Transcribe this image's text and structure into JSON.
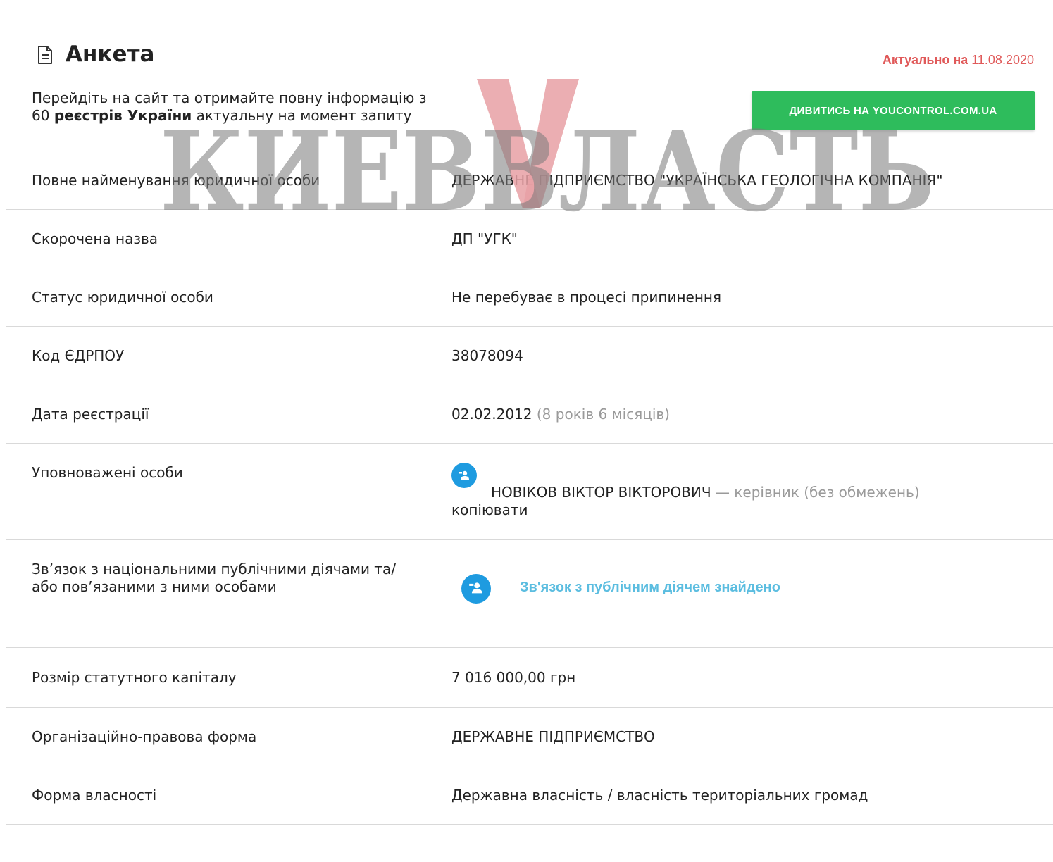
{
  "header": {
    "title": "Анкета",
    "actual_label": "Актуально на",
    "actual_date": "11.08.2020",
    "promo_line1": "Перейдіть на сайт та отримайте повну інформацію з",
    "promo_count": "60",
    "promo_bold": "реєстрів України",
    "promo_tail": "актуальну на момент запиту",
    "cta_label": "ДИВИТИСЬ НА YOUCONTROL.COM.UA"
  },
  "watermark": {
    "text": "КИЕВВЛАСТЬ"
  },
  "rows": [
    {
      "label": "Повне найменування юридичної особи",
      "value": "ДЕРЖАВНЕ ПІДПРИЄМСТВО \"УКРАЇНСЬКА ГЕОЛОГІЧНА КОМПАНІЯ\""
    },
    {
      "label": "Скорочена назва",
      "value": "ДП \"УГК\""
    },
    {
      "label": "Статус юридичної особи",
      "value": "Не перебуває в процесі припинення"
    },
    {
      "label": "Код ЄДРПОУ",
      "value": "38078094"
    },
    {
      "label": "Дата реєстрації",
      "value": "02.02.2012",
      "value_note": "(8 років 6 місяців)"
    },
    {
      "label": "Уповноважені особи",
      "person_name": "НОВІКОВ ВІКТОР ВІКТОРОВИЧ",
      "person_role": "— керівник (без обмежень)",
      "copy_label": "копіювати"
    },
    {
      "label": "Зв’язок з національними публічними діячами та/або пов’язаними з ними особами",
      "link_label": "Зв'язок з публічним діячем знайдено"
    },
    {
      "label": "Розмір статутного капіталу",
      "value": "7 016 000,00 грн"
    },
    {
      "label": "Організаційно-правова форма",
      "value": "ДЕРЖАВНЕ ПІДПРИЄМСТВО"
    },
    {
      "label": "Форма власності",
      "value": "Державна власність / власність територіальних громад"
    }
  ],
  "colors": {
    "cta": "#2ebc5c",
    "accent_red": "#e05a5a",
    "icon_blue": "#1e9be0",
    "link_blue": "#5bbde0"
  }
}
